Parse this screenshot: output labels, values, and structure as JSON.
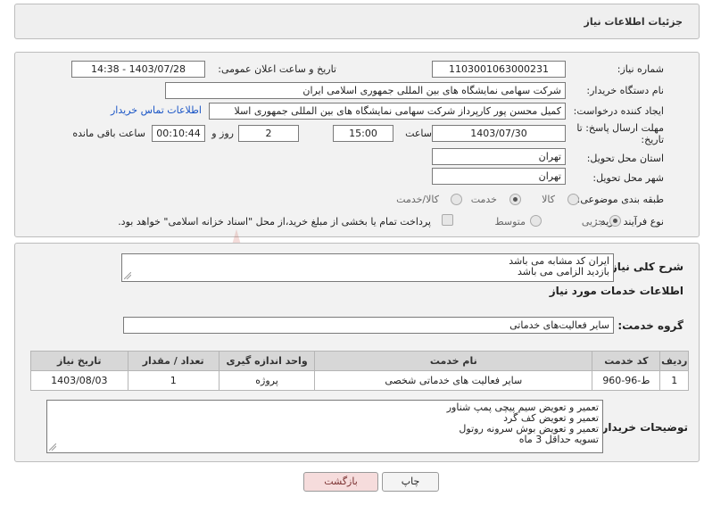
{
  "header": {
    "title": "جزئیات اطلاعات نیاز"
  },
  "form": {
    "need_number_label": "شماره نیاز:",
    "need_number": "1103001063000231",
    "announce_label": "تاریخ و ساعت اعلان عمومی:",
    "announce_value": "1403/07/28 - 14:38",
    "buyer_org_label": "نام دستگاه خریدار:",
    "buyer_org": "شرکت سهامی نمایشگاه های بین المللی جمهوری اسلامی ایران",
    "creator_label": "ایجاد کننده درخواست:",
    "creator": "کمیل محسن پور کارپرداز شرکت سهامی نمایشگاه های بین المللی جمهوری اسلا",
    "contact_link": "اطلاعات تماس خریدار",
    "deadline_label": "مهلت ارسال پاسخ: تا تاریخ:",
    "deadline_date": "1403/07/30",
    "time_label": "ساعت",
    "deadline_time": "15:00",
    "days_value": "2",
    "days_label": "روز و",
    "remaining_time": "00:10:44",
    "remaining_label": "ساعت باقی مانده",
    "province_label": "استان محل تحویل:",
    "province": "تهران",
    "city_label": "شهر محل تحویل:",
    "city": "تهران",
    "category_label": "طبقه بندی موضوعی:",
    "category_options": [
      "کالا",
      "خدمت",
      "کالا/خدمت"
    ],
    "category_selected": "خدمت",
    "process_label": "نوع فرآیند خرید :",
    "process_options": [
      "جزیی",
      "متوسط"
    ],
    "process_selected": "جزیی",
    "payment_note": "پرداخت تمام یا بخشی از مبلغ خرید،از محل \"اسناد خزانه اسلامی\" خواهد بود."
  },
  "description": {
    "label": "شرح کلی نیاز:",
    "lines": [
      "ایران کد مشابه می باشد",
      "بازدید الزامی می باشد"
    ]
  },
  "services": {
    "section_title": "اطلاعات خدمات مورد نیاز",
    "group_label": "گروه خدمت:",
    "group_value": "سایر فعالیت‌های خدماتی",
    "columns": [
      "ردیف",
      "کد خدمت",
      "نام خدمت",
      "واحد اندازه گیری",
      "تعداد / مقدار",
      "تاریخ نیاز"
    ],
    "rows": [
      [
        "1",
        "ط-96-960",
        "سایر فعالیت های خدماتی شخصی",
        "پروژه",
        "1",
        "1403/08/03"
      ]
    ]
  },
  "buyer_notes": {
    "label": "توضیحات خریدار:",
    "lines": [
      "تعمیر و تعویض سیم پیچی پمپ شناور",
      "تعمیر و تعویض کف گرد",
      "تعمیر و تعویض بوش سرونه روتول",
      "تسویه حداقل 3 ماه"
    ]
  },
  "buttons": {
    "print": "چاپ",
    "back": "بازگشت"
  },
  "watermark": {
    "text": "AriaTender.net"
  },
  "colors": {
    "link": "#1a55c6",
    "back_button": "#f6dcdc",
    "watermark": "#c0392b"
  }
}
